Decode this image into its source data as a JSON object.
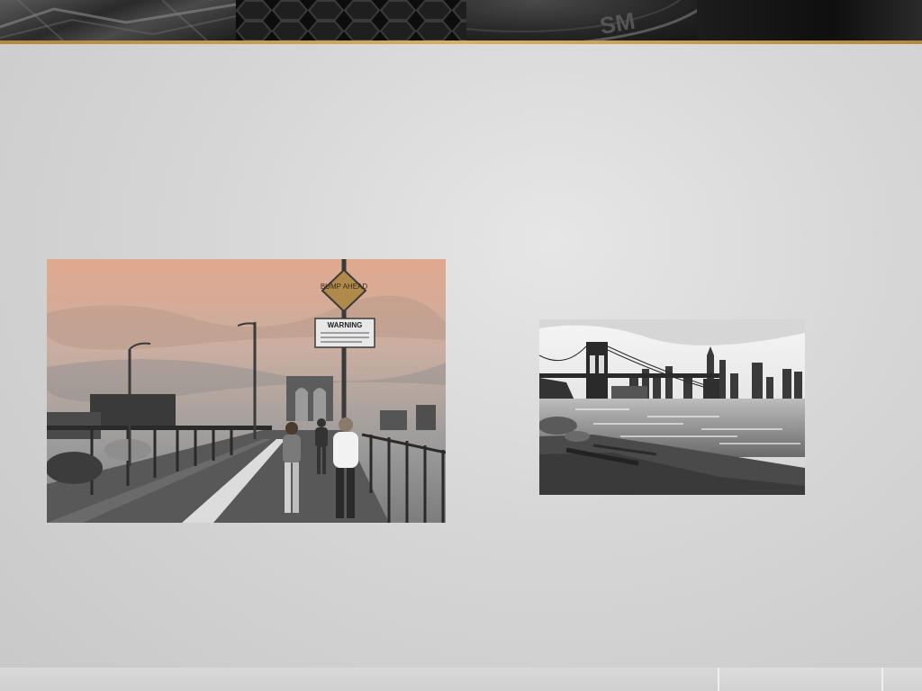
{
  "slide": {
    "header": {
      "accent_color": "#c9a24a",
      "tire_text": "SM"
    },
    "images": [
      {
        "name": "brooklyn-bridge-walkway-photo",
        "description_hidden": true
      },
      {
        "name": "brooklyn-bridge-skyline-photo",
        "description_hidden": true
      }
    ],
    "walkway_photo": {
      "sign_top": "BUMP AHEAD",
      "sign_warning": "WARNING"
    }
  }
}
